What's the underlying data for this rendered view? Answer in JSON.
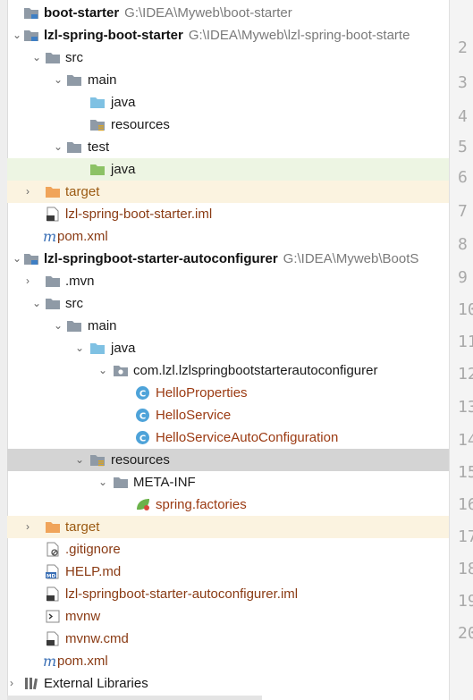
{
  "tree": {
    "rows": [
      {
        "label": "boot-starter",
        "path": "G:\\IDEA\\Myweb\\boot-starter"
      },
      {
        "label": "lzl-spring-boot-starter",
        "path": "G:\\IDEA\\Myweb\\lzl-spring-boot-starte"
      },
      {
        "label": "src"
      },
      {
        "label": "main"
      },
      {
        "label": "java"
      },
      {
        "label": "resources"
      },
      {
        "label": "test"
      },
      {
        "label": "java"
      },
      {
        "label": "target"
      },
      {
        "label": "lzl-spring-boot-starter.iml"
      },
      {
        "label": "pom.xml"
      },
      {
        "label": "lzl-springboot-starter-autoconfigurer",
        "path": "G:\\IDEA\\Myweb\\BootS"
      },
      {
        "label": ".mvn"
      },
      {
        "label": "src"
      },
      {
        "label": "main"
      },
      {
        "label": "java"
      },
      {
        "label": "com.lzl.lzlspringbootstarterautoconfigurer"
      },
      {
        "label": "HelloProperties"
      },
      {
        "label": "HelloService"
      },
      {
        "label": "HelloServiceAutoConfiguration"
      },
      {
        "label": "resources"
      },
      {
        "label": "META-INF"
      },
      {
        "label": "spring.factories"
      },
      {
        "label": "target"
      },
      {
        "label": ".gitignore"
      },
      {
        "label": "HELP.md"
      },
      {
        "label": "lzl-springboot-starter-autoconfigurer.iml"
      },
      {
        "label": "mvnw"
      },
      {
        "label": "mvnw.cmd"
      },
      {
        "label": "pom.xml"
      },
      {
        "label": "External Libraries"
      }
    ]
  },
  "icon_badges": {
    "md": "MD"
  },
  "gutter": {
    "lines": [
      "2",
      "3",
      "4",
      "5",
      "6",
      "7",
      "8",
      "9",
      "10",
      "11",
      "12",
      "13",
      "14",
      "15",
      "16",
      "17",
      "18",
      "19",
      "20"
    ]
  }
}
